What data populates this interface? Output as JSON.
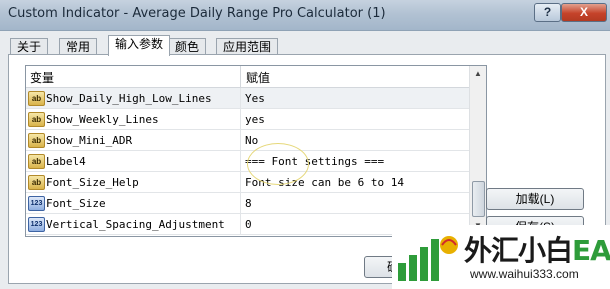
{
  "window": {
    "title": "Custom Indicator - Average Daily Range Pro Calculator (1)",
    "help_label": "?",
    "close_label": "X"
  },
  "tabs": [
    {
      "label": "关于"
    },
    {
      "label": "常用"
    },
    {
      "label": "输入参数",
      "active": true
    },
    {
      "label": "颜色"
    },
    {
      "label": "应用范围"
    }
  ],
  "grid": {
    "columns": [
      "变量",
      "赋值"
    ],
    "rows": [
      {
        "icon": "ab",
        "name": "Show_Daily_High_Low_Lines",
        "value": "Yes"
      },
      {
        "icon": "ab",
        "name": "Show_Weekly_Lines",
        "value": "yes"
      },
      {
        "icon": "ab",
        "name": "Show_Mini_ADR",
        "value": "No"
      },
      {
        "icon": "ab",
        "name": "Label4",
        "value": "=== Font settings ==="
      },
      {
        "icon": "ab",
        "name": "Font_Size_Help",
        "value": "Font size can be 6 to 14"
      },
      {
        "icon": "123",
        "name": "Font_Size",
        "value": "8"
      },
      {
        "icon": "123",
        "name": "Vertical_Spacing_Adjustment",
        "value": "0"
      }
    ]
  },
  "buttons": {
    "load": "加载(L)",
    "save": "保存(S)",
    "ok": "确"
  },
  "watermark": {
    "text_cn": "外汇小白",
    "text_ea": "EA网",
    "url": "www.waihui333.com"
  },
  "colors": {
    "accent_green": "#2e9c3a",
    "close_red": "#c5432a"
  }
}
